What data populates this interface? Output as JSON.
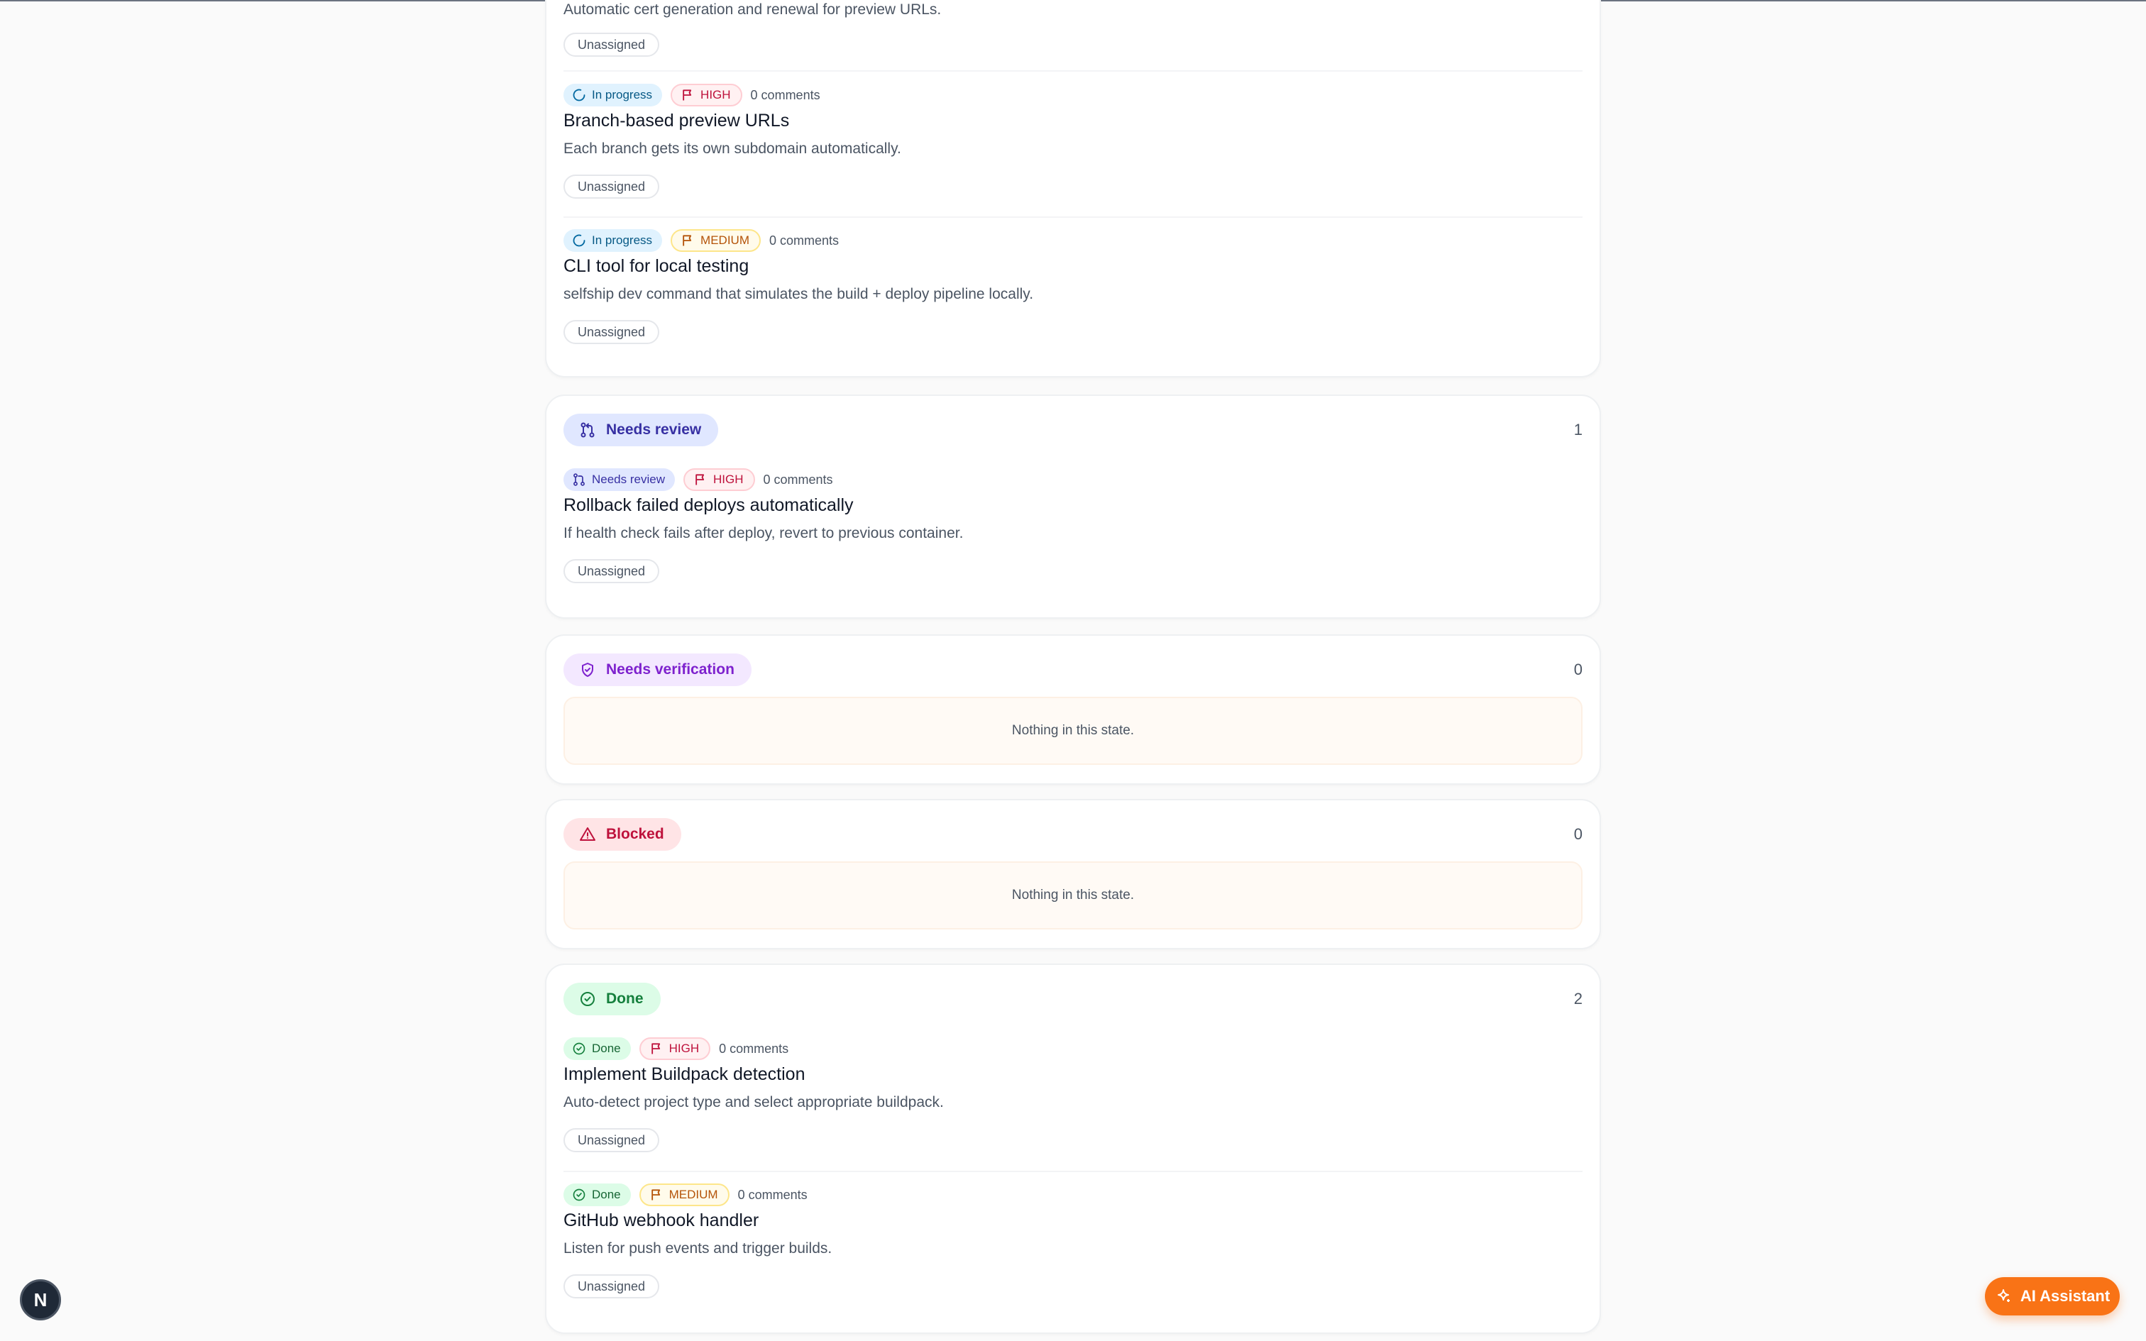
{
  "colors": {
    "in_progress": "#0369a1",
    "needs_review": "#3730a3",
    "needs_verification": "#7e22ce",
    "blocked": "#be123c",
    "done": "#15803d",
    "priority_high": "#be123c",
    "priority_medium": "#b45309",
    "accent": "#f97316"
  },
  "top_issue": {
    "description": "Automatic cert generation and renewal for preview URLs.",
    "assignee": "Unassigned"
  },
  "in_progress": {
    "issues": [
      {
        "status": "In progress",
        "priority": "HIGH",
        "comments": "0 comments",
        "title": "Branch-based preview URLs",
        "description": "Each branch gets its own subdomain automatically.",
        "assignee": "Unassigned"
      },
      {
        "status": "In progress",
        "priority": "MEDIUM",
        "comments": "0 comments",
        "title": "CLI tool for local testing",
        "description": "selfship dev command that simulates the build + deploy pipeline locally.",
        "assignee": "Unassigned"
      }
    ]
  },
  "needs_review": {
    "label": "Needs review",
    "count": "1",
    "icon": "git-pull-request-icon",
    "issues": [
      {
        "status": "Needs review",
        "priority": "HIGH",
        "comments": "0 comments",
        "title": "Rollback failed deploys automatically",
        "description": "If health check fails after deploy, revert to previous container.",
        "assignee": "Unassigned"
      }
    ]
  },
  "needs_verification": {
    "label": "Needs verification",
    "count": "0",
    "icon": "shield-check-icon",
    "empty_text": "Nothing in this state."
  },
  "blocked": {
    "label": "Blocked",
    "count": "0",
    "icon": "alert-triangle-icon",
    "empty_text": "Nothing in this state."
  },
  "done": {
    "label": "Done",
    "count": "2",
    "icon": "check-circle-icon",
    "issues": [
      {
        "status": "Done",
        "priority": "HIGH",
        "comments": "0 comments",
        "title": "Implement Buildpack detection",
        "description": "Auto-detect project type and select appropriate buildpack.",
        "assignee": "Unassigned"
      },
      {
        "status": "Done",
        "priority": "MEDIUM",
        "comments": "0 comments",
        "title": "GitHub webhook handler",
        "description": "Listen for push events and trigger builds.",
        "assignee": "Unassigned"
      }
    ]
  },
  "dev_badge": {
    "letter": "N"
  },
  "ai_assistant": {
    "label": "AI Assistant",
    "icon": "sparkle-icon"
  }
}
